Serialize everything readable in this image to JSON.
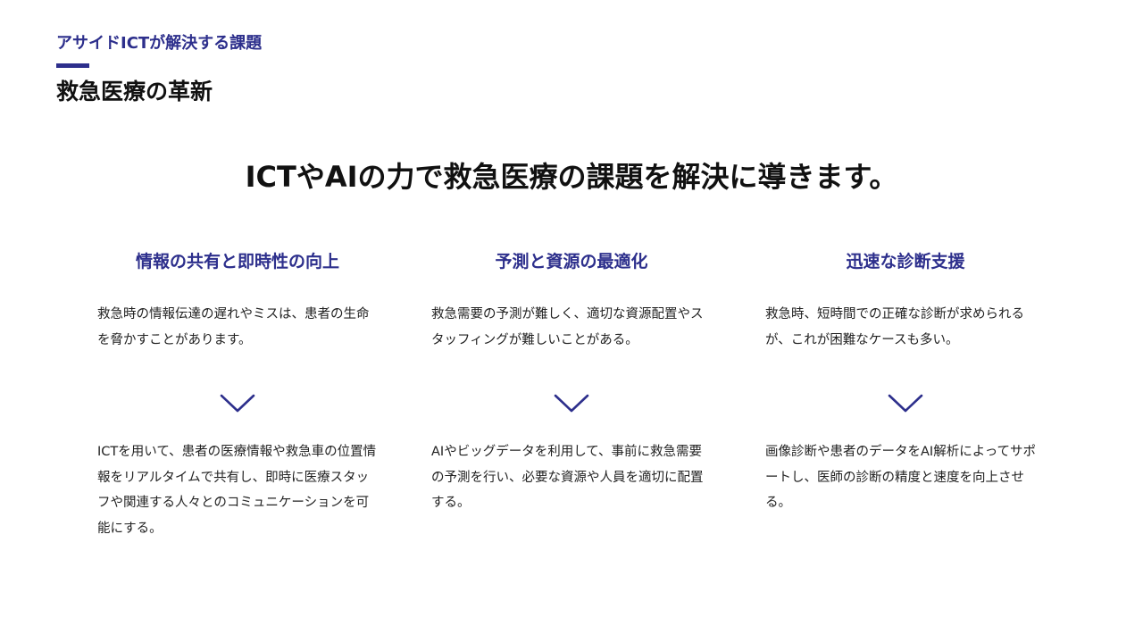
{
  "header": {
    "eyebrow": "アサイドICTが解決する課題",
    "title": "救急医療の革新"
  },
  "headline": "ICTやAIの力で救急医療の課題を解決に導きます。",
  "accent_color": "#2d2f8c",
  "columns": [
    {
      "title": "情報の共有と即時性の向上",
      "problem": "救急時の情報伝達の遅れやミスは、患者の生命を脅かすことがあります。",
      "solution": "ICTを用いて、患者の医療情報や救急車の位置情報をリアルタイムで共有し、即時に医療スタッフや関連する人々とのコミュニケーションを可能にする。",
      "icon": "chevron-down-icon"
    },
    {
      "title": "予測と資源の最適化",
      "problem": "救急需要の予測が難しく、適切な資源配置やスタッフィングが難しいことがある。",
      "solution": "AIやビッグデータを利用して、事前に救急需要の予測を行い、必要な資源や人員を適切に配置する。",
      "icon": "chevron-down-icon"
    },
    {
      "title": "迅速な診断支援",
      "problem": "救急時、短時間での正確な診断が求められるが、これが困難なケースも多い。",
      "solution": "画像診断や患者のデータをAI解析によってサポートし、医師の診断の精度と速度を向上させる。",
      "icon": "chevron-down-icon"
    }
  ]
}
